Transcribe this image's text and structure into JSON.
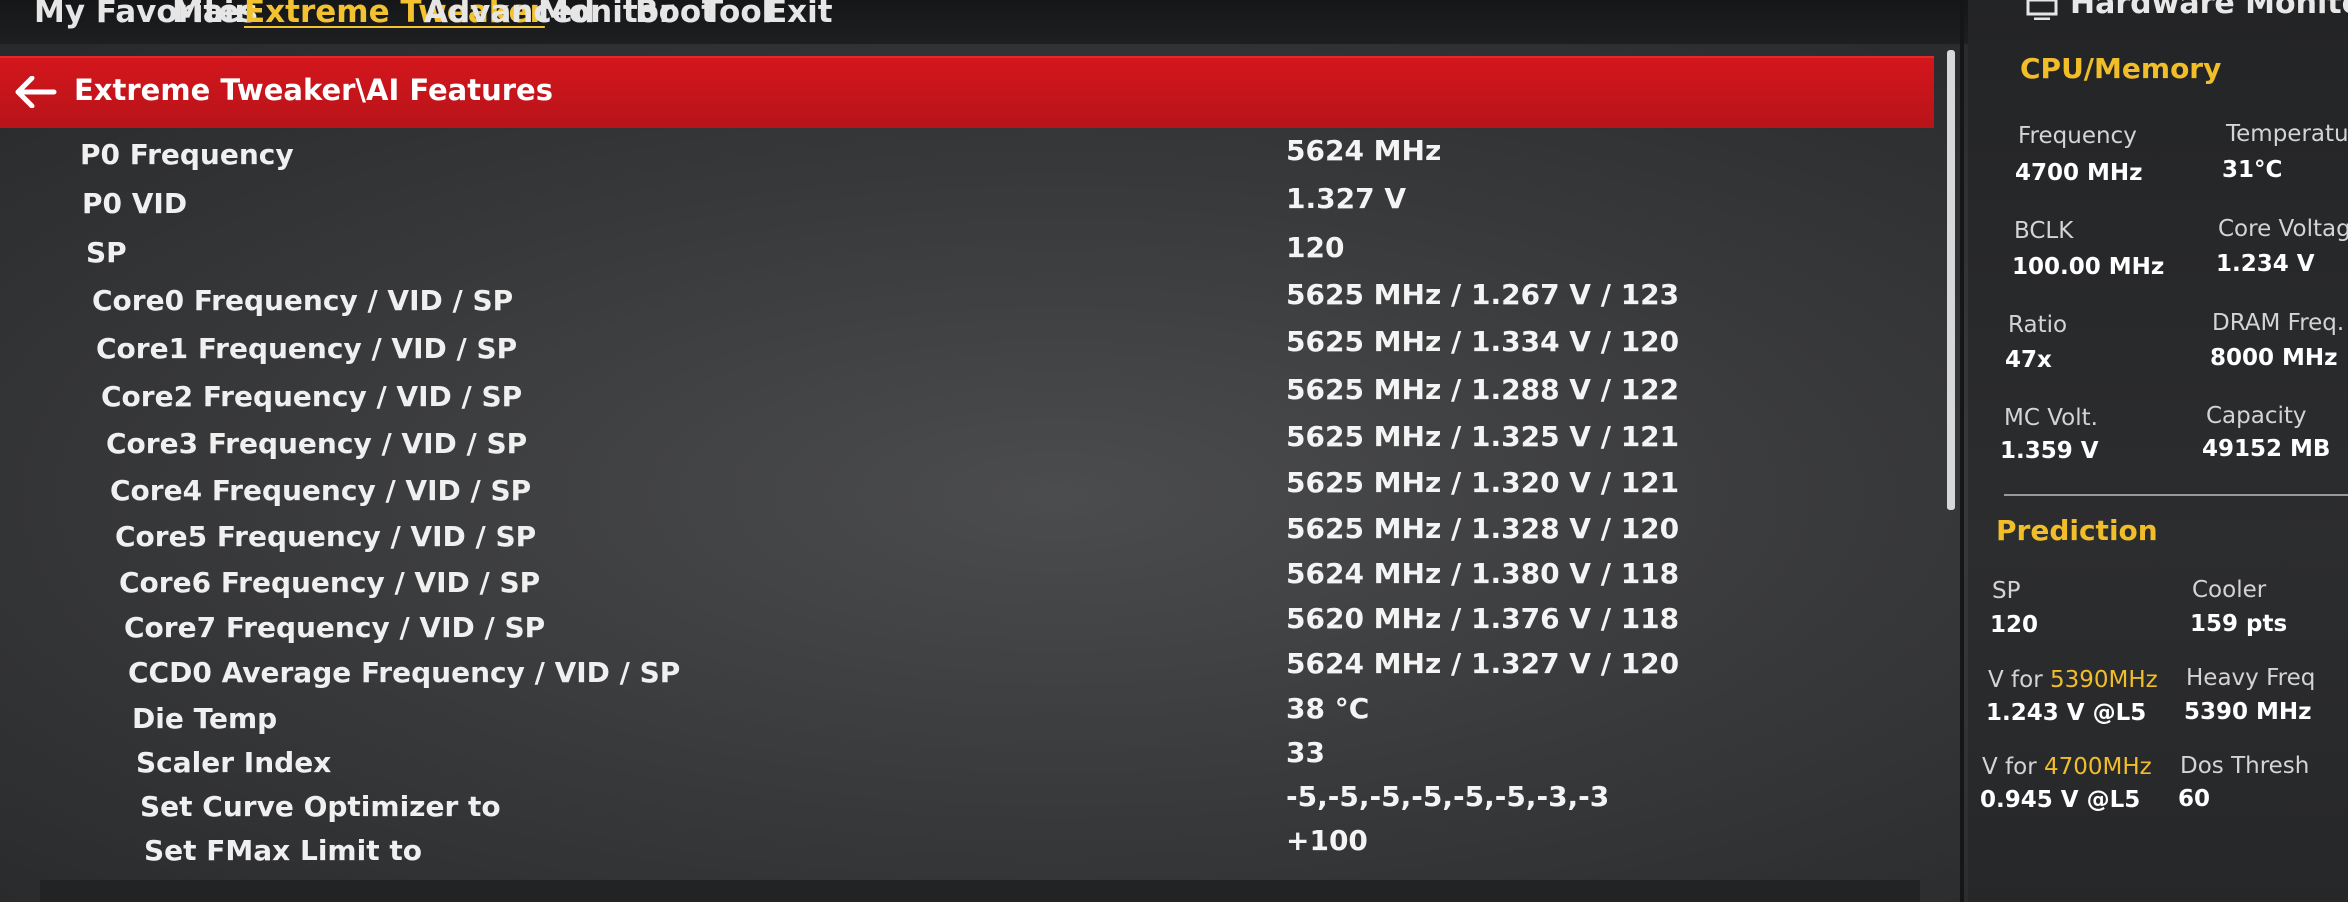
{
  "menu": {
    "items": [
      "My Favorites",
      "Main",
      "Extreme Tweaker",
      "Advanced",
      "Monitor",
      "Boot",
      "Tool",
      "Exit"
    ],
    "active": "Extreme Tweaker"
  },
  "breadcrumb": "Extreme Tweaker\\AI Features",
  "rows": [
    {
      "label": "P0 Frequency",
      "value": "5624 MHz"
    },
    {
      "label": "P0 VID",
      "value": "1.327 V"
    },
    {
      "label": "SP",
      "value": "120"
    },
    {
      "label": "Core0 Frequency / VID / SP",
      "value": "5625 MHz / 1.267 V / 123"
    },
    {
      "label": "Core1 Frequency / VID / SP",
      "value": "5625 MHz / 1.334 V / 120"
    },
    {
      "label": "Core2 Frequency / VID / SP",
      "value": "5625 MHz / 1.288 V / 122"
    },
    {
      "label": "Core3 Frequency / VID / SP",
      "value": "5625 MHz / 1.325 V / 121"
    },
    {
      "label": "Core4 Frequency / VID / SP",
      "value": "5625 MHz / 1.320 V / 121"
    },
    {
      "label": "Core5 Frequency / VID / SP",
      "value": "5625 MHz / 1.328 V / 120"
    },
    {
      "label": "Core6 Frequency / VID / SP",
      "value": "5624 MHz / 1.380 V / 118"
    },
    {
      "label": "Core7 Frequency / VID / SP",
      "value": "5620 MHz / 1.376 V / 118"
    },
    {
      "label": "CCD0 Average Frequency / VID / SP",
      "value": "5624 MHz / 1.327 V / 120"
    },
    {
      "label": "Die Temp",
      "value": "38 °C"
    },
    {
      "label": "Scaler Index",
      "value": "33"
    },
    {
      "label": "Set Curve Optimizer to",
      "value": "-5,-5,-5,-5,-5,-5,-3,-3"
    },
    {
      "label": "Set FMax Limit to",
      "value": "+100"
    }
  ],
  "hardware_monitor": {
    "title": "Hardware Monitor",
    "cpu_memory": {
      "heading": "CPU/Memory",
      "frequency_label": "Frequency",
      "frequency_value": "4700 MHz",
      "temperature_label": "Temperatu",
      "temperature_value": "31°C",
      "bclk_label": "BCLK",
      "bclk_value": "100.00 MHz",
      "core_voltage_label": "Core Voltage",
      "core_voltage_value": "1.234 V",
      "ratio_label": "Ratio",
      "ratio_value": "47x",
      "dram_freq_label": "DRAM Freq.",
      "dram_freq_value": "8000 MHz",
      "mc_volt_label": "MC Volt.",
      "mc_volt_value": "1.359 V",
      "capacity_label": "Capacity",
      "capacity_value": "49152 MB"
    },
    "prediction": {
      "heading": "Prediction",
      "sp_label": "SP",
      "sp_value": "120",
      "cooler_label": "Cooler",
      "cooler_value": "159 pts",
      "v_for_1_prefix": "V for ",
      "v_for_1_freq": "5390MHz",
      "v_for_1_value": "1.243 V @L5",
      "heavy_freq_label": "Heavy Freq",
      "heavy_freq_value": "5390 MHz",
      "v_for_2_prefix": "V for ",
      "v_for_2_freq": "4700MHz",
      "v_for_2_value": "0.945 V @L5",
      "dos_thresh_label": "Dos Thresh",
      "dos_thresh_value": "60"
    }
  },
  "colors": {
    "accent": "#f2c230",
    "breadcrumb_red": "#c8151b"
  },
  "icons": [
    "back-arrow-icon",
    "monitor-icon"
  ]
}
